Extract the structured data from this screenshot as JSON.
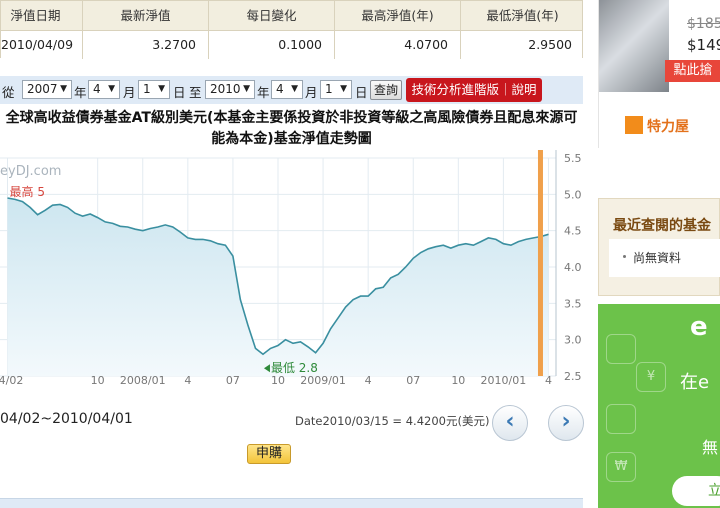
{
  "stats": {
    "headers": [
      "淨值日期",
      "最新淨值",
      "每日變化",
      "最高淨值(年)",
      "最低淨值(年)"
    ],
    "values": [
      "2010/04/09",
      "3.2700",
      "0.1000",
      "4.0700",
      "2.9500"
    ]
  },
  "filter": {
    "from_label": "從",
    "from_year": "2007",
    "year_unit": "年",
    "from_month": "4",
    "month_unit": "月",
    "from_day": "1",
    "day_unit": "日",
    "to_label": "至",
    "to_year": "2010",
    "to_month": "4",
    "to_day": "1",
    "query_button": "查詢",
    "advanced_button": "技術分析進階版｜說明"
  },
  "chart_title": "全球高收益債券基金AT級別美元(本基金主要係投資於非投資等級之高風險債券且配息來源可能為本金)基金淨值走勢圖",
  "chart_data": {
    "type": "area",
    "title": "全球高收益債券基金AT級別美元(本基金主要係投資於非投資等級之高風險債券且配息來源可能為本金)基金淨值走勢圖",
    "watermark": "eyDJ.com",
    "ylim": [
      2.5,
      5.5
    ],
    "yticks": [
      2.5,
      3.0,
      3.5,
      4.0,
      4.5,
      5.0,
      5.5
    ],
    "ytick_labels": [
      "2.5",
      "3.0",
      "3.5",
      "4.0",
      "4.5",
      "5.0",
      "5.5"
    ],
    "xtick_labels": [
      "04/02",
      "10",
      "2008/01",
      "4",
      "07",
      "10",
      "2009/01",
      "4",
      "07",
      "10",
      "2010/01",
      "4"
    ],
    "xtick_months": [
      0,
      6,
      9,
      12,
      15,
      18,
      21,
      24,
      27,
      30,
      33,
      36
    ],
    "annotation_high": "最高 5",
    "annotation_low": "最低 2.8",
    "series": [
      {
        "x": [
          0,
          0.5,
          1,
          1.5,
          2,
          2.5,
          3,
          3.5,
          4,
          4.5,
          5,
          5.5,
          6,
          6.5,
          7,
          7.5,
          8,
          8.5,
          9,
          9.5,
          10,
          10.5,
          11,
          11.5,
          12,
          12.5,
          13,
          13.5,
          14,
          14.5,
          15,
          15.5,
          16,
          16.5,
          17,
          17.5,
          18,
          18.5,
          19,
          19.5,
          20,
          20.5,
          21,
          21.5,
          22,
          22.5,
          23,
          23.5,
          24,
          24.5,
          25,
          25.5,
          26,
          26.5,
          27,
          27.5,
          28,
          28.5,
          29,
          29.5,
          30,
          30.5,
          31,
          31.5,
          32,
          32.5,
          33,
          33.5,
          34,
          34.5,
          35,
          35.5,
          36
        ],
        "y": [
          4.95,
          4.93,
          4.9,
          4.82,
          4.72,
          4.78,
          4.85,
          4.86,
          4.82,
          4.74,
          4.7,
          4.73,
          4.68,
          4.62,
          4.6,
          4.56,
          4.55,
          4.52,
          4.5,
          4.53,
          4.55,
          4.58,
          4.55,
          4.48,
          4.4,
          4.38,
          4.38,
          4.36,
          4.32,
          4.3,
          4.15,
          3.55,
          3.2,
          2.88,
          2.8,
          2.88,
          2.92,
          3.0,
          2.95,
          2.97,
          2.9,
          2.82,
          2.95,
          3.15,
          3.3,
          3.45,
          3.55,
          3.6,
          3.6,
          3.7,
          3.72,
          3.85,
          3.9,
          4.0,
          4.12,
          4.2,
          4.25,
          4.28,
          4.3,
          4.26,
          4.3,
          4.32,
          4.3,
          4.35,
          4.4,
          4.38,
          4.32,
          4.3,
          4.35,
          4.38,
          4.4,
          4.42,
          4.45
        ]
      }
    ]
  },
  "range_text": "04/02~2010/04/01",
  "date_info": "Date2010/03/15 = 4.4200元(美元)",
  "nav": {
    "prev": "‹",
    "next": "›"
  },
  "buy_button": "申購",
  "ad_top": {
    "old_price": "$185",
    "price": "$149",
    "cta": "點此搶",
    "brand": "特力屋"
  },
  "recent": {
    "title": "最近查閱的基金",
    "empty": "尚無資料"
  },
  "ad_bottom": {
    "logo": "e",
    "line1": "在e",
    "line2": "無",
    "cta": "立"
  },
  "colors": {
    "line": "#3a8fa0",
    "fill_top": "#cde6f0",
    "fill_bottom": "#eef7fb",
    "accent": "#c8161d",
    "marker": "#f0a04b"
  }
}
